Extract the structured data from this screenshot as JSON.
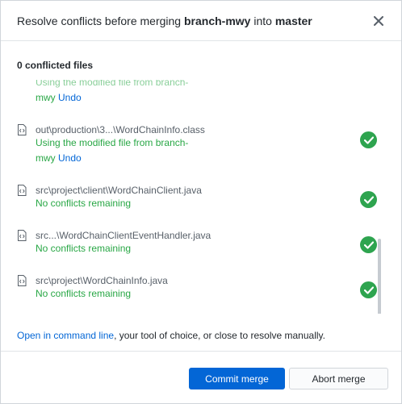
{
  "dialog": {
    "title_prefix": "Resolve conflicts before merging ",
    "source_branch": "branch-mwy",
    "title_middle": " into ",
    "target_branch": "master",
    "summary": "0 conflicted files",
    "files": [
      {
        "path": "",
        "status_line1": "Using the modified file from branch-",
        "status_line2": "mwy",
        "undo": "Undo",
        "state": "partial"
      },
      {
        "path": "out\\production\\3...\\WordChainInfo.class",
        "status_line1": "Using the modified file from branch-",
        "status_line2": "mwy",
        "undo": "Undo",
        "state": "resolved"
      },
      {
        "path": "src\\project\\client\\WordChainClient.java",
        "status": "No conflicts remaining",
        "state": "resolved"
      },
      {
        "path": "src...\\WordChainClientEventHandler.java",
        "status": "No conflicts remaining",
        "state": "resolved"
      },
      {
        "path": "src\\project\\WordChainInfo.java",
        "status": "No conflicts remaining",
        "state": "resolved"
      }
    ],
    "footer_link": "Open in command line",
    "footer_rest": ", your tool of choice, or close to resolve manually.",
    "commit_button": "Commit merge",
    "abort_button": "Abort merge"
  },
  "icons": {
    "close": "close-icon",
    "file": "file-code-icon",
    "check": "check-circle-icon"
  },
  "colors": {
    "accent": "#0366d6",
    "success": "#2ea44f",
    "status_text": "#28a745"
  }
}
